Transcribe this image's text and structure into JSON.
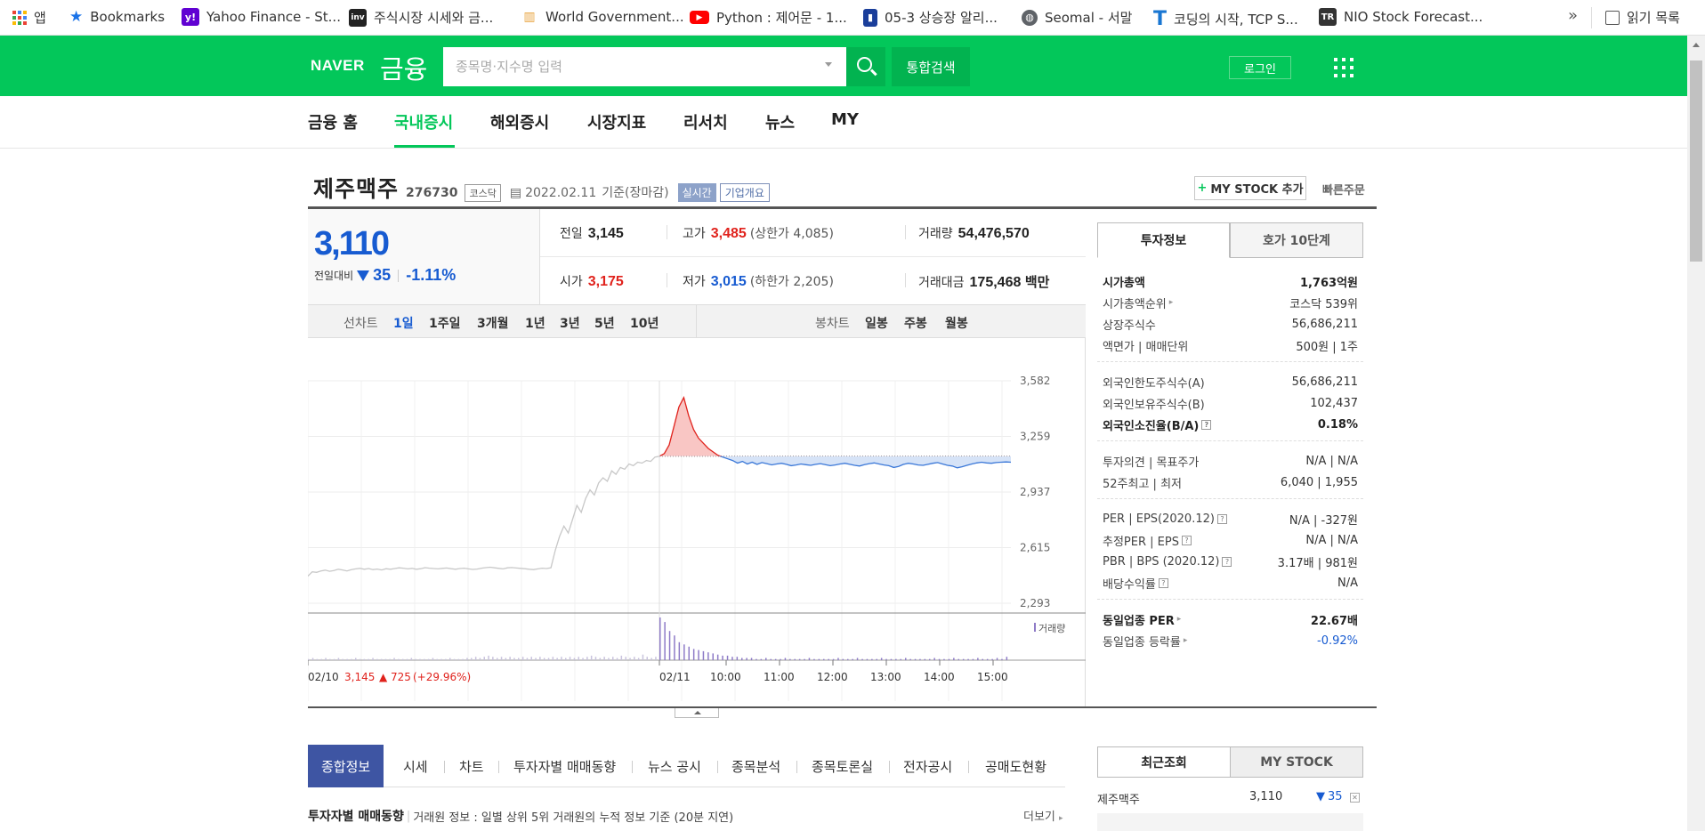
{
  "bookmarks": [
    {
      "label": "앱",
      "icon": "apps-icon",
      "color": "#4285f4"
    },
    {
      "label": "Bookmarks",
      "icon": "star-icon",
      "color": "#1a73e8"
    },
    {
      "label": "Yahoo Finance - St...",
      "icon": "yahoo-icon",
      "color": "#6001d2"
    },
    {
      "label": "주식시장 시세와 금...",
      "icon": "investing-icon",
      "color": "#222222"
    },
    {
      "label": "World Government...",
      "icon": "worldgov-icon",
      "color": "#e8a33d"
    },
    {
      "label": "Python : 제어문 - 1...",
      "icon": "youtube-icon",
      "color": "#ff0000"
    },
    {
      "label": "05-3 상승장 알리...",
      "icon": "book-icon",
      "color": "#1a3e9a"
    },
    {
      "label": "Seomal - 서말",
      "icon": "globe-icon",
      "color": "#5f6368"
    },
    {
      "label": "코딩의 시작, TCP S...",
      "icon": "tcp-icon",
      "color": "#1976d2"
    },
    {
      "label": "NIO Stock Forecast...",
      "icon": "tr-icon",
      "color": "#333333"
    }
  ],
  "bookmarks_more": "»",
  "reading_list": "읽기 목록",
  "header": {
    "logo_naver": "NAVER",
    "logo_finance": "금융",
    "search_placeholder": "종목명·지수명 입력",
    "total_search": "통합검색",
    "login": "로그인",
    "brand_color": "#03c75a"
  },
  "nav": [
    {
      "label": "금융 홈",
      "active": false
    },
    {
      "label": "국내증시",
      "active": true
    },
    {
      "label": "해외증시",
      "active": false
    },
    {
      "label": "시장지표",
      "active": false
    },
    {
      "label": "리서치",
      "active": false
    },
    {
      "label": "뉴스",
      "active": false
    },
    {
      "label": "MY",
      "active": false
    }
  ],
  "stock": {
    "name": "제주맥주",
    "code": "276730",
    "market": "코스닥",
    "date": "2022.02.11",
    "date_basis": "기준(장마감)",
    "live_tag": "실시간",
    "corp_tag": "기업개요",
    "add_mystock": "MY STOCK 추가",
    "quick_order": "빠른주문",
    "price": "3,110",
    "diff_label": "전일대비",
    "diff": "35",
    "diff_pct": "-1.11%",
    "quote": {
      "prev_label": "전일",
      "prev": "3,145",
      "high_label": "고가",
      "high": "3,485",
      "upper_limit": "(상한가 4,085)",
      "volume_label": "거래량",
      "volume": "54,476,570",
      "open_label": "시가",
      "open": "3,175",
      "low_label": "저가",
      "low": "3,015",
      "lower_limit": "(하한가 2,205)",
      "amount_label": "거래대금",
      "amount": "175,468",
      "amount_unit": "백만"
    }
  },
  "ranges": {
    "line_label": "선차트",
    "line_items": [
      "1일",
      "1주일",
      "3개월",
      "1년",
      "3년",
      "5년",
      "10년"
    ],
    "active": "1일",
    "candle_label": "봉차트",
    "candle_items": [
      "일봉",
      "주봉",
      "월봉"
    ]
  },
  "chart_data": {
    "type": "line",
    "title": "",
    "ylim": [
      2293,
      3582
    ],
    "y_ticks": [
      "3,582",
      "3,259",
      "2,937",
      "2,615",
      "2,293"
    ],
    "x_ticks": [
      "02/10",
      "02/11",
      "10:00",
      "11:00",
      "12:00",
      "13:00",
      "14:00",
      "15:00"
    ],
    "prev_close": 3145,
    "day1_label": "02/10",
    "day1_summary": "3,145",
    "day1_change": "725",
    "day1_change_pct": "(+29.96%)",
    "volume_legend": "거래량",
    "series": [
      {
        "name": "02/10",
        "values": [
          2450,
          2475,
          2472,
          2480,
          2485,
          2478,
          2482,
          2490,
          2486,
          2480,
          2488,
          2492,
          2495,
          2490,
          2494,
          2488,
          2491,
          2486,
          2493,
          2490,
          2494,
          2498,
          2496,
          2492,
          2495,
          2490,
          2493,
          2499,
          2496,
          2494,
          2492,
          2495,
          2497,
          2493,
          2490,
          2494,
          2496,
          2492,
          2489,
          2491,
          2496,
          2499,
          2502,
          2498,
          2495,
          2492,
          2498,
          2500,
          2497,
          2495,
          2493,
          2490,
          2488,
          2492,
          2496,
          2494,
          2498,
          2600,
          2680,
          2740,
          2700,
          2780,
          2860,
          2820,
          2900,
          2950,
          2920,
          2990,
          3020,
          3000,
          3060,
          3040,
          3080,
          3070,
          3100,
          3090,
          3110,
          3105,
          3120,
          3115,
          3140,
          3145
        ]
      },
      {
        "name": "02/11",
        "values": [
          3145,
          3160,
          3210,
          3320,
          3430,
          3485,
          3380,
          3300,
          3250,
          3220,
          3190,
          3170,
          3150,
          3140,
          3130,
          3120,
          3105,
          3115,
          3100,
          3110,
          3098,
          3108,
          3102,
          3095,
          3100,
          3104,
          3098,
          3090,
          3094,
          3100,
          3096,
          3092,
          3098,
          3102,
          3096,
          3090,
          3094,
          3100,
          3104,
          3098,
          3092,
          3088,
          3096,
          3102,
          3106,
          3100,
          3094,
          3090,
          3080,
          3086,
          3098,
          3104,
          3100,
          3094,
          3092,
          3098,
          3104,
          3108,
          3100,
          3092,
          3088,
          3078,
          3084,
          3092,
          3100,
          3106,
          3110,
          3106,
          3104,
          3108,
          3110,
          3112,
          3110
        ]
      }
    ],
    "volume_day1": [
      1,
      2,
      1,
      1,
      2,
      1,
      1,
      2,
      1,
      1,
      1,
      2,
      1,
      1,
      1,
      2,
      1,
      1,
      1,
      1,
      2,
      1,
      1,
      1,
      2,
      1,
      1,
      1,
      1,
      2,
      1,
      1,
      1,
      2,
      1,
      1,
      1,
      2,
      2,
      3,
      2,
      3,
      4,
      3,
      2,
      3,
      2,
      3,
      2,
      2,
      3,
      2,
      3,
      2,
      3,
      2,
      2,
      3,
      2,
      3,
      2,
      3,
      2,
      3,
      2,
      3,
      4,
      3,
      2,
      3,
      2,
      3,
      2,
      4,
      3,
      2,
      3,
      2,
      5,
      3,
      2,
      3
    ],
    "volume_day2": [
      38,
      34,
      26,
      22,
      16,
      14,
      12,
      10,
      9,
      8,
      7,
      6,
      5,
      4,
      4,
      3,
      3,
      2,
      2,
      2,
      1,
      1,
      2,
      1,
      1,
      1,
      2,
      1,
      1,
      1,
      1,
      2,
      1,
      1,
      1,
      1,
      1,
      2,
      1,
      1,
      1,
      2,
      1,
      1,
      1,
      1,
      2,
      1,
      1,
      1,
      1,
      2,
      1,
      1,
      1,
      1,
      1,
      2,
      1,
      1,
      1,
      2,
      1,
      1,
      1,
      1,
      2,
      1,
      1,
      1,
      2,
      1,
      3
    ]
  },
  "invest_tabs": [
    "투자정보",
    "호가 10단계"
  ],
  "invest_info": [
    [
      {
        "k": "시가총액",
        "v": "1,763억원",
        "bold": true
      },
      {
        "k": "시가총액순위",
        "v": "코스닥 539위",
        "arrow": true
      },
      {
        "k": "상장주식수",
        "v": "56,686,211"
      },
      {
        "k": "액면가 | 매매단위",
        "v": "500원 | 1주"
      }
    ],
    [
      {
        "k": "외국인한도주식수(A)",
        "v": "56,686,211"
      },
      {
        "k": "외국인보유주식수(B)",
        "v": "102,437"
      },
      {
        "k": "외국인소진율(B/A)",
        "v": "0.18%",
        "bold": true,
        "q": true
      }
    ],
    [
      {
        "k": "투자의견 | 목표주가",
        "v": "N/A | N/A"
      },
      {
        "k": "52주최고 | 최저",
        "v": "6,040 | 1,955"
      }
    ],
    [
      {
        "k": "PER | EPS(2020.12)",
        "v": "N/A | -327원",
        "q": true
      },
      {
        "k": "추정PER | EPS",
        "v": "N/A | N/A",
        "q": true
      },
      {
        "k": "PBR | BPS (2020.12)",
        "v": "3.17배 | 981원",
        "q": true
      },
      {
        "k": "배당수익률",
        "v": "N/A",
        "q": true
      }
    ],
    [
      {
        "k": "동일업종 PER",
        "v": "22.67배",
        "bold": true,
        "arrow": true
      },
      {
        "k": "동일업종 등락률",
        "v": "-0.92%",
        "arrow": true,
        "blue": true
      }
    ]
  ],
  "bottom_tabs": [
    "종합정보",
    "시세",
    "차트",
    "투자자별 매매동향",
    "뉴스 공시",
    "종목분석",
    "종목토론실",
    "전자공시",
    "공매도현황"
  ],
  "investor_section": {
    "title": "투자자별 매매동향",
    "desc": "거래원 정보 : 일별 상위 5위 거래원의 누적 정보 기준 (20분 지연)",
    "more": "더보기"
  },
  "recent": {
    "tabs": [
      "최근조회",
      "MY STOCK"
    ],
    "item_name": "제주맥주",
    "item_price": "3,110",
    "item_diff": "35"
  }
}
